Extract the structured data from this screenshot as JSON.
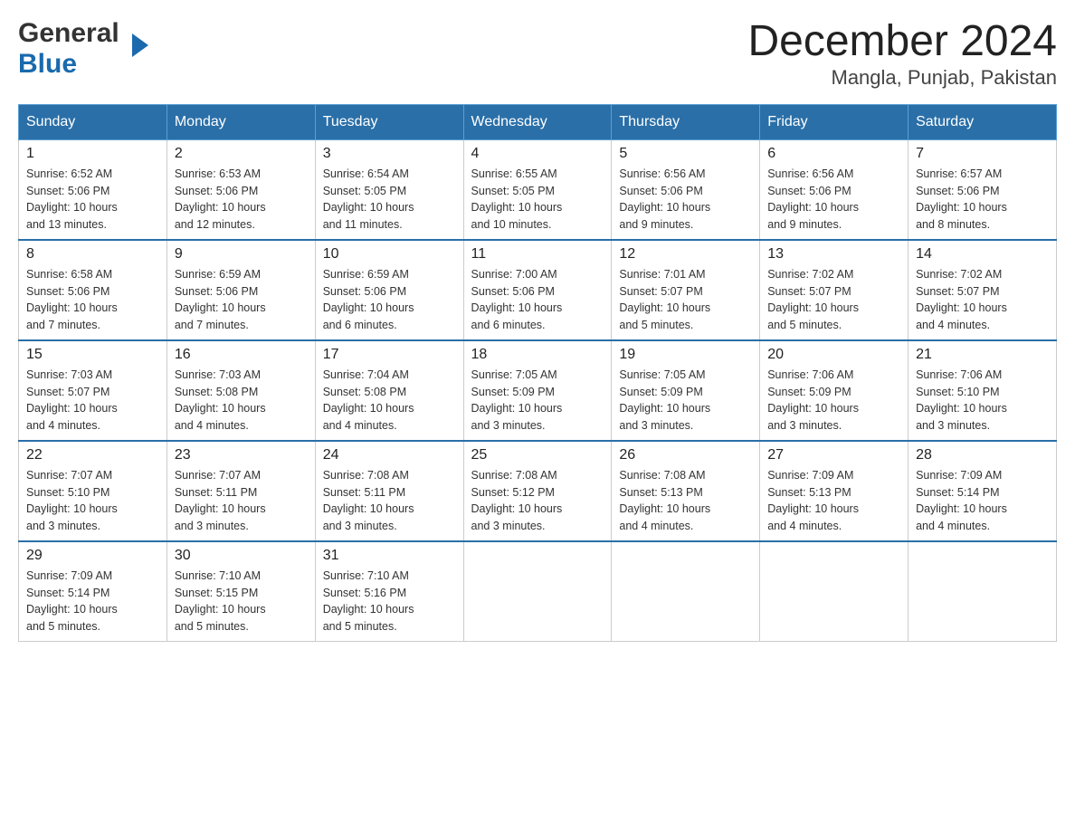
{
  "logo": {
    "general": "General",
    "blue": "Blue",
    "arrow": "▶"
  },
  "title": "December 2024",
  "subtitle": "Mangla, Punjab, Pakistan",
  "weekdays": [
    "Sunday",
    "Monday",
    "Tuesday",
    "Wednesday",
    "Thursday",
    "Friday",
    "Saturday"
  ],
  "weeks": [
    [
      {
        "day": "1",
        "sunrise": "6:52 AM",
        "sunset": "5:06 PM",
        "daylight": "10 hours and 13 minutes."
      },
      {
        "day": "2",
        "sunrise": "6:53 AM",
        "sunset": "5:06 PM",
        "daylight": "10 hours and 12 minutes."
      },
      {
        "day": "3",
        "sunrise": "6:54 AM",
        "sunset": "5:05 PM",
        "daylight": "10 hours and 11 minutes."
      },
      {
        "day": "4",
        "sunrise": "6:55 AM",
        "sunset": "5:05 PM",
        "daylight": "10 hours and 10 minutes."
      },
      {
        "day": "5",
        "sunrise": "6:56 AM",
        "sunset": "5:06 PM",
        "daylight": "10 hours and 9 minutes."
      },
      {
        "day": "6",
        "sunrise": "6:56 AM",
        "sunset": "5:06 PM",
        "daylight": "10 hours and 9 minutes."
      },
      {
        "day": "7",
        "sunrise": "6:57 AM",
        "sunset": "5:06 PM",
        "daylight": "10 hours and 8 minutes."
      }
    ],
    [
      {
        "day": "8",
        "sunrise": "6:58 AM",
        "sunset": "5:06 PM",
        "daylight": "10 hours and 7 minutes."
      },
      {
        "day": "9",
        "sunrise": "6:59 AM",
        "sunset": "5:06 PM",
        "daylight": "10 hours and 7 minutes."
      },
      {
        "day": "10",
        "sunrise": "6:59 AM",
        "sunset": "5:06 PM",
        "daylight": "10 hours and 6 minutes."
      },
      {
        "day": "11",
        "sunrise": "7:00 AM",
        "sunset": "5:06 PM",
        "daylight": "10 hours and 6 minutes."
      },
      {
        "day": "12",
        "sunrise": "7:01 AM",
        "sunset": "5:07 PM",
        "daylight": "10 hours and 5 minutes."
      },
      {
        "day": "13",
        "sunrise": "7:02 AM",
        "sunset": "5:07 PM",
        "daylight": "10 hours and 5 minutes."
      },
      {
        "day": "14",
        "sunrise": "7:02 AM",
        "sunset": "5:07 PM",
        "daylight": "10 hours and 4 minutes."
      }
    ],
    [
      {
        "day": "15",
        "sunrise": "7:03 AM",
        "sunset": "5:07 PM",
        "daylight": "10 hours and 4 minutes."
      },
      {
        "day": "16",
        "sunrise": "7:03 AM",
        "sunset": "5:08 PM",
        "daylight": "10 hours and 4 minutes."
      },
      {
        "day": "17",
        "sunrise": "7:04 AM",
        "sunset": "5:08 PM",
        "daylight": "10 hours and 4 minutes."
      },
      {
        "day": "18",
        "sunrise": "7:05 AM",
        "sunset": "5:09 PM",
        "daylight": "10 hours and 3 minutes."
      },
      {
        "day": "19",
        "sunrise": "7:05 AM",
        "sunset": "5:09 PM",
        "daylight": "10 hours and 3 minutes."
      },
      {
        "day": "20",
        "sunrise": "7:06 AM",
        "sunset": "5:09 PM",
        "daylight": "10 hours and 3 minutes."
      },
      {
        "day": "21",
        "sunrise": "7:06 AM",
        "sunset": "5:10 PM",
        "daylight": "10 hours and 3 minutes."
      }
    ],
    [
      {
        "day": "22",
        "sunrise": "7:07 AM",
        "sunset": "5:10 PM",
        "daylight": "10 hours and 3 minutes."
      },
      {
        "day": "23",
        "sunrise": "7:07 AM",
        "sunset": "5:11 PM",
        "daylight": "10 hours and 3 minutes."
      },
      {
        "day": "24",
        "sunrise": "7:08 AM",
        "sunset": "5:11 PM",
        "daylight": "10 hours and 3 minutes."
      },
      {
        "day": "25",
        "sunrise": "7:08 AM",
        "sunset": "5:12 PM",
        "daylight": "10 hours and 3 minutes."
      },
      {
        "day": "26",
        "sunrise": "7:08 AM",
        "sunset": "5:13 PM",
        "daylight": "10 hours and 4 minutes."
      },
      {
        "day": "27",
        "sunrise": "7:09 AM",
        "sunset": "5:13 PM",
        "daylight": "10 hours and 4 minutes."
      },
      {
        "day": "28",
        "sunrise": "7:09 AM",
        "sunset": "5:14 PM",
        "daylight": "10 hours and 4 minutes."
      }
    ],
    [
      {
        "day": "29",
        "sunrise": "7:09 AM",
        "sunset": "5:14 PM",
        "daylight": "10 hours and 5 minutes."
      },
      {
        "day": "30",
        "sunrise": "7:10 AM",
        "sunset": "5:15 PM",
        "daylight": "10 hours and 5 minutes."
      },
      {
        "day": "31",
        "sunrise": "7:10 AM",
        "sunset": "5:16 PM",
        "daylight": "10 hours and 5 minutes."
      },
      null,
      null,
      null,
      null
    ]
  ],
  "labels": {
    "sunrise": "Sunrise:",
    "sunset": "Sunset:",
    "daylight": "Daylight:"
  }
}
